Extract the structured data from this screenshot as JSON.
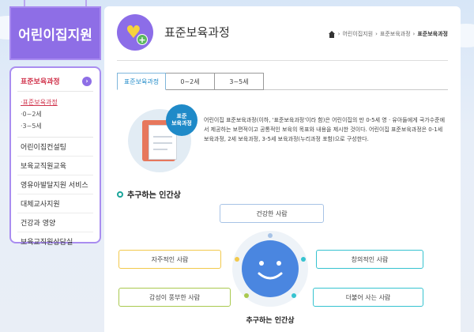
{
  "sidebar": {
    "title": "어린이집지원",
    "active_label": "표준보육과정",
    "sub_items": [
      "·표준보육과정",
      "·0~2세",
      "·3~5세"
    ],
    "items": [
      "어린이집컨설팅",
      "보육교직원교육",
      "영유아발달지원 서비스",
      "대체교사지원",
      "건강과 영양",
      "보육교직원상담실"
    ]
  },
  "header": {
    "title": "표준보육과정",
    "breadcrumb": [
      "어린이집지원",
      "표준보육과정",
      "표준보육과정"
    ]
  },
  "tabs": [
    {
      "label": "표준보육과정",
      "active": true
    },
    {
      "label": "0~2세",
      "active": false
    },
    {
      "label": "3~5세",
      "active": false
    }
  ],
  "intro": {
    "badge": "표준\n보육과정",
    "text": "어린이집 표준보육과정(이하, '표준보육과정'이라 함)은 어린이집의 만 0-5세 영 · 유아들에게 국가수준에서 제공하는 보편적이고 공통적인 보육의 목표와 내용을 제시한 것이다. 어린이집 표준보육과정은 0-1세 보육과정, 2세 보육과정, 3-5세 보육과정(누리과정 포함)으로 구성한다."
  },
  "ideal": {
    "heading": "추구하는 인간상",
    "center_caption": "추구하는 인간상",
    "nodes": [
      {
        "label": "건강한 사람",
        "color": "#a7c3e6"
      },
      {
        "label": "자주적인 사람",
        "color": "#f2c94c"
      },
      {
        "label": "창의적인 사람",
        "color": "#36c3d0"
      },
      {
        "label": "감성이 풍부한 사람",
        "color": "#a9c94f"
      },
      {
        "label": "더불어 사는 사람",
        "color": "#36c3d0"
      }
    ]
  },
  "colors": {
    "accent_purple": "#8e6ee6",
    "tab_blue": "#1f8ac8",
    "smile_blue": "#4a86e0"
  }
}
